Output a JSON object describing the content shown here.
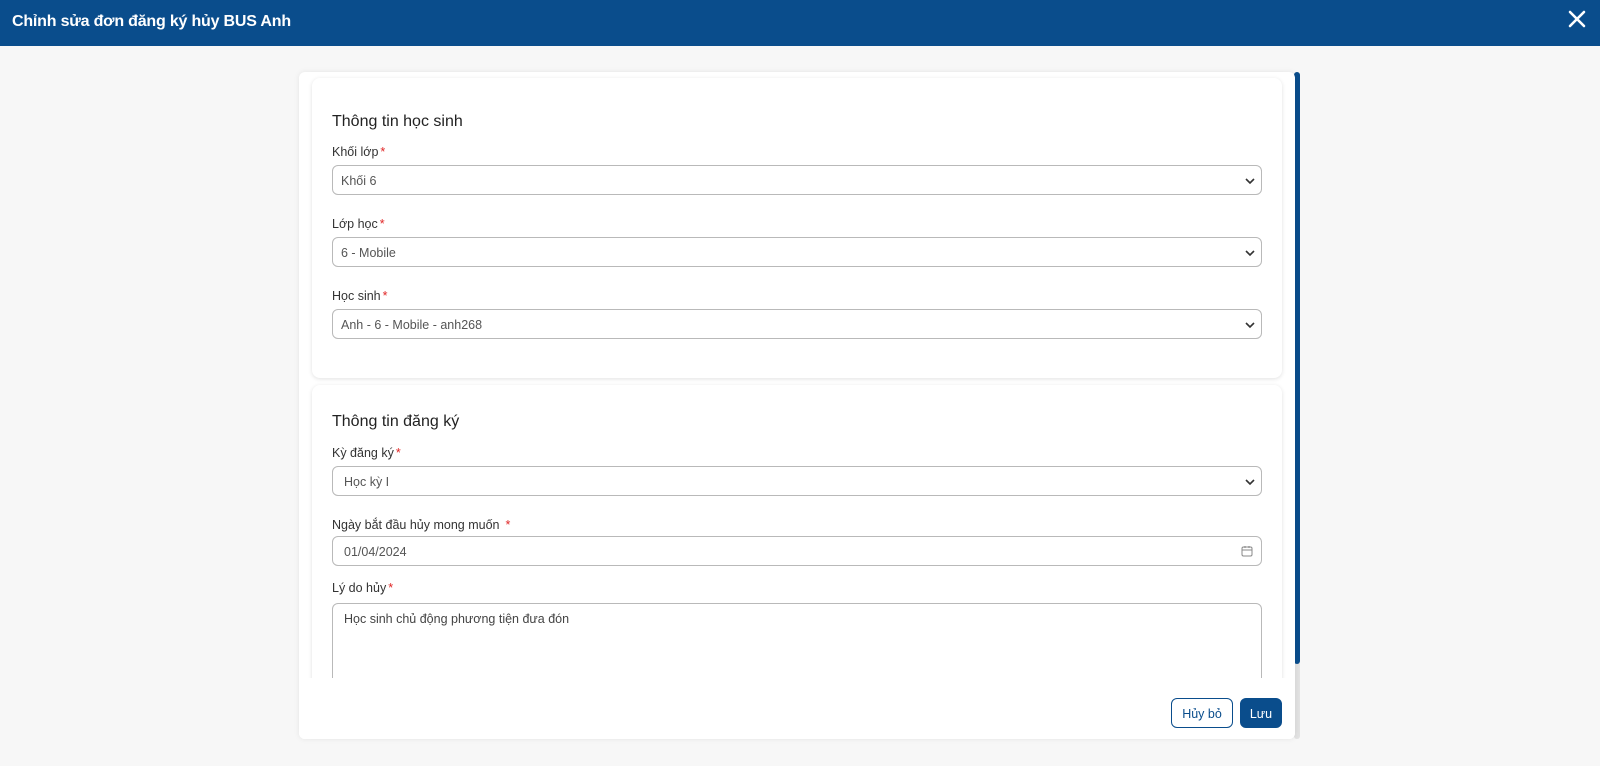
{
  "header": {
    "title": "Chỉnh sửa đơn đăng ký hủy BUS Anh",
    "close_icon": "close-icon"
  },
  "student_info": {
    "title": "Thông tin học sinh",
    "grade": {
      "label": "Khối lớp",
      "value": "Khối 6"
    },
    "class": {
      "label": "Lớp học",
      "value": "6 - Mobile"
    },
    "student": {
      "label": "Học sinh",
      "value": "Anh - 6 - Mobile - anh268"
    }
  },
  "registration_info": {
    "title": "Thông tin đăng ký",
    "term": {
      "label": "Kỳ đăng ký",
      "value": "Học kỳ I"
    },
    "start_date": {
      "label": "Ngày bắt đầu hủy mong muốn",
      "value": "01/04/2024",
      "icon": "calendar-icon"
    },
    "reason": {
      "label": "Lý do hủy",
      "value": "Học sinh chủ động phương tiện đưa đón"
    }
  },
  "footer": {
    "cancel_label": "Hủy bỏ",
    "save_label": "Lưu"
  },
  "required_mark": "*",
  "colors": {
    "primary": "#0a4d8c",
    "required": "#e02424",
    "background": "#f7f7f7"
  }
}
